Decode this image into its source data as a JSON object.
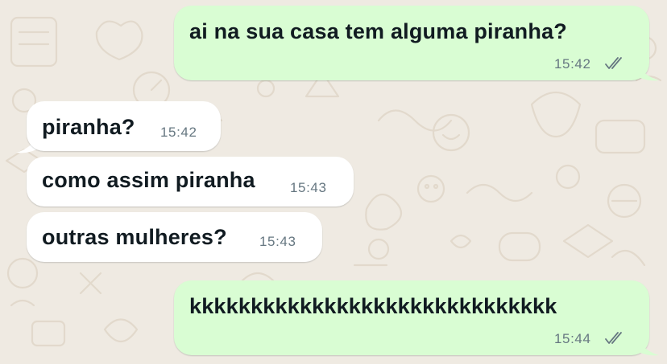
{
  "theme": {
    "wallpaper": "#efeae2",
    "outgoing_bubble": "#d9fdd3",
    "incoming_bubble": "#ffffff",
    "message_text": "#111b21",
    "meta_text": "#667781",
    "read_ticks_icon": "double-check-icon"
  },
  "messages": [
    {
      "direction": "outgoing",
      "text": "ai na sua casa tem alguma piranha?",
      "time": "15:42",
      "status": "sent"
    },
    {
      "direction": "incoming",
      "text": "piranha?",
      "time": "15:42"
    },
    {
      "direction": "incoming",
      "text": "como assim piranha",
      "time": "15:43"
    },
    {
      "direction": "incoming",
      "text": "outras mulheres?",
      "time": "15:43"
    },
    {
      "direction": "outgoing",
      "text": "kkkkkkkkkkkkkkkkkkkkkkkkkkkkkk",
      "time": "15:44",
      "status": "sent"
    }
  ]
}
